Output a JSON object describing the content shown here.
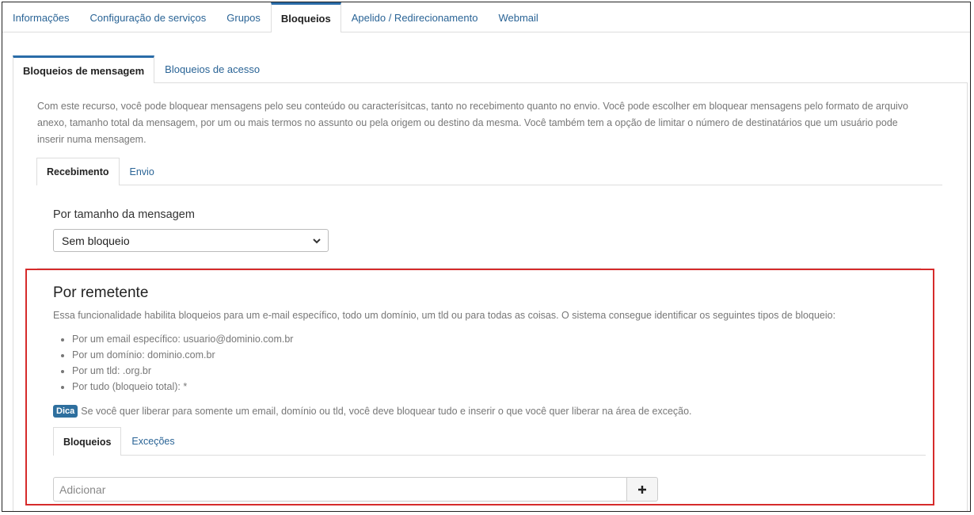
{
  "main_tabs": [
    {
      "label": "Informações",
      "active": false
    },
    {
      "label": "Configuração de serviços",
      "active": false
    },
    {
      "label": "Grupos",
      "active": false
    },
    {
      "label": "Bloqueios",
      "active": true
    },
    {
      "label": "Apelido / Redirecionamento",
      "active": false
    },
    {
      "label": "Webmail",
      "active": false
    }
  ],
  "sub_tabs": [
    {
      "label": "Bloqueios de mensagem",
      "active": true
    },
    {
      "label": "Bloqueios de acesso",
      "active": false
    }
  ],
  "description": "Com este recurso, você pode bloquear mensagens pelo seu conteúdo ou caracterísitcas, tanto no recebimento quanto no envio. Você pode escolher em bloquear mensagens pelo formato de arquivo anexo, tamanho total da mensagem, por um ou mais termos no assunto ou pela origem ou destino da mesma. Você também tem a opção de limitar o número de destinatários que um usuário pode inserir numa mensagem.",
  "direction_tabs": [
    {
      "label": "Recebimento",
      "active": true
    },
    {
      "label": "Envio",
      "active": false
    }
  ],
  "size_filter": {
    "label": "Por tamanho da mensagem",
    "selected": "Sem bloqueio"
  },
  "sender": {
    "title": "Por remetente",
    "description": "Essa funcionalidade habilita bloqueios para um e-mail específico, todo um domínio, um tld ou para todas as coisas. O sistema consegue identificar os seguintes tipos de bloqueio:",
    "items": [
      "Por um email específico: usuario@dominio.com.br",
      "Por um domínio: dominio.com.br",
      "Por um tld: .org.br",
      "Por tudo (bloqueio total): *"
    ],
    "tip_badge": "Dica",
    "tip_text": "Se você quer liberar para somente um email, domínio ou tld, você deve bloquear tudo e inserir o que você quer liberar na área de exceção.",
    "tabs": [
      {
        "label": "Bloqueios",
        "active": true
      },
      {
        "label": "Exceções",
        "active": false
      }
    ],
    "add_placeholder": "Adicionar",
    "add_icon": "plus-icon"
  },
  "colors": {
    "accent": "#2a6ca8",
    "link": "#2a6496",
    "highlight": "#d62b2b",
    "badge": "#2e6f9e"
  }
}
